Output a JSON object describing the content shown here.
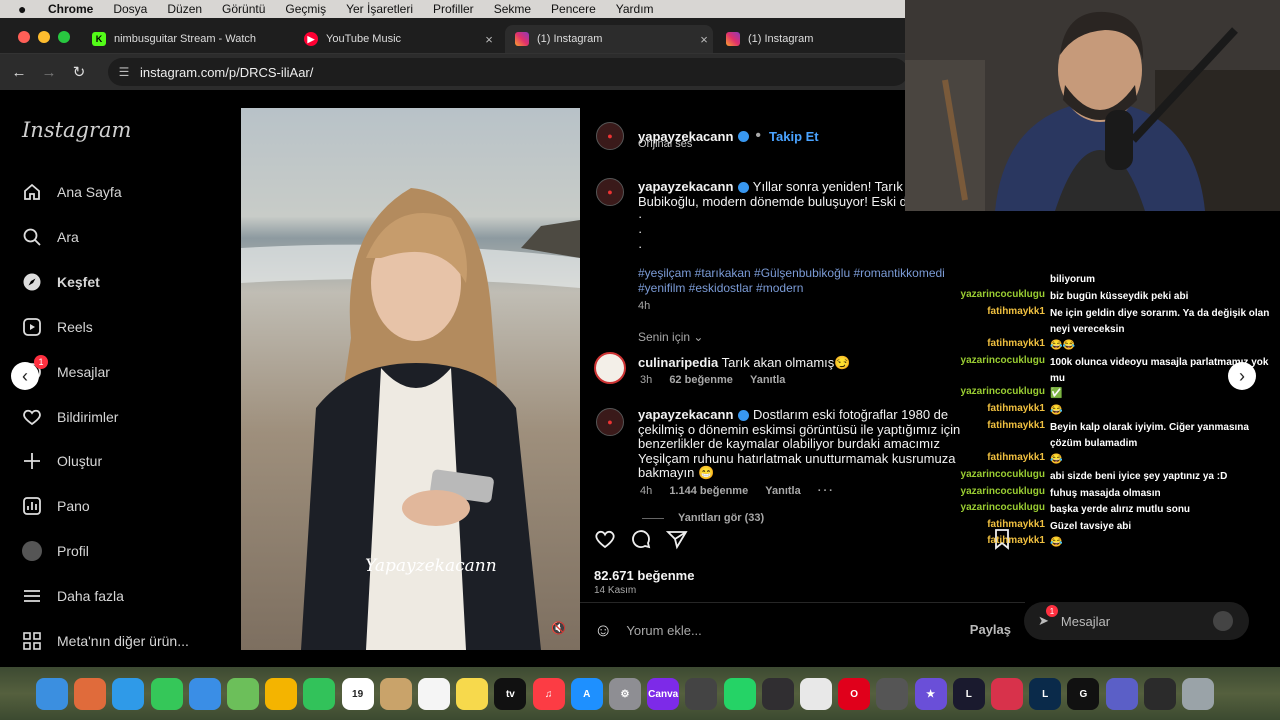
{
  "menubar": {
    "app": "Chrome",
    "items": [
      "Dosya",
      "Düzen",
      "Görüntü",
      "Geçmiş",
      "Yer İşaretleri",
      "Profiller",
      "Sekme",
      "Pencere",
      "Yardım"
    ]
  },
  "tabs": [
    {
      "title": "nimbusguitar Stream - Watch",
      "icon": "kick-icon",
      "color": "#53fc18"
    },
    {
      "title": "YouTube Music",
      "icon": "youtube-music-icon",
      "color": "#ff0033"
    },
    {
      "title": "(1) Instagram",
      "icon": "instagram-icon",
      "color": "#e1306c"
    },
    {
      "title": "(1) Instagram",
      "icon": "instagram-icon",
      "color": "#e1306c"
    }
  ],
  "address": {
    "url": "instagram.com/p/DRCS-iliAar/"
  },
  "sidebar": {
    "logo": "Instagram",
    "items": [
      {
        "label": "Ana Sayfa",
        "icon": "home-icon"
      },
      {
        "label": "Ara",
        "icon": "search-icon"
      },
      {
        "label": "Keşfet",
        "icon": "compass-icon"
      },
      {
        "label": "Reels",
        "icon": "reels-icon"
      },
      {
        "label": "Mesajlar",
        "icon": "messenger-icon",
        "badge": "1"
      },
      {
        "label": "Bildirimler",
        "icon": "heart-icon"
      },
      {
        "label": "Oluştur",
        "icon": "plus-icon"
      },
      {
        "label": "Pano",
        "icon": "dashboard-icon"
      },
      {
        "label": "Profil",
        "icon": "avatar"
      },
      {
        "label": "Daha fazla",
        "icon": "menu-icon"
      },
      {
        "label": "Meta'nın diğer ürün...",
        "icon": "apps-icon"
      }
    ]
  },
  "post": {
    "watermark": "Yapayzekacann",
    "author": "yapayzekacann",
    "follow": "Takip Et",
    "audio": "Orijinal ses",
    "caption_user": "yapayzekacann",
    "caption_line1": "Yıllar sonra yeniden! Tarık A",
    "caption_line2": "Bubikoğlu, modern dönemde buluşuyor! Eski d",
    "dots": [
      "·",
      "·",
      "·"
    ],
    "hashtags_line1": "#yeşilçam #tarıkakan #Gülşenbubikoğlu #romantikkomedi",
    "hashtags_line2": "#yenifilm #eskidostlar #modern",
    "caption_time": "4h",
    "for_you": "Senin için",
    "comments": [
      {
        "user": "culinaripedia",
        "text": "Tarık akan olmamış😏",
        "time": "3h",
        "likes": "62 beğenme",
        "reply": "Yanıtla"
      },
      {
        "user": "yapayzekacann",
        "text": "Dostlarım eski fotoğraflar 1980 de çekilmiş o dönemin eskimsi görüntüsü ile yaptığımız için benzerlikler de kaymalar olabiliyor burdaki amacımız Yeşilçam ruhunu hatırlatmak unutturmamak kusrumuza bakmayın 😁",
        "time": "4h",
        "likes": "1.144 beğenme",
        "reply": "Yanıtla"
      }
    ],
    "view_replies": "Yanıtları gör (33)",
    "likes_total": "82.671 beğenme",
    "date": "14 Kasım",
    "comment_placeholder": "Yorum ekle...",
    "share": "Paylaş"
  },
  "chat": [
    {
      "user": "",
      "msg": "biliyorum",
      "color": "#f0e68c"
    },
    {
      "user": "yazarincocuklugu",
      "msg": "biz bugün küsseydik peki abi",
      "color": "#9acd32"
    },
    {
      "user": "fatihmaykk1",
      "msg": "Ne için geldin diye sorarım. Ya da değişik olan neyi vereceksin",
      "color": "#f0c040"
    },
    {
      "user": "fatihmaykk1",
      "msg": "😂😂",
      "color": "#f0c040"
    },
    {
      "user": "yazarincocuklugu",
      "msg": "100k olunca videoyu masajla parlatmamız yok mu",
      "color": "#9acd32"
    },
    {
      "user": "yazarincocuklugu",
      "msg": "✅",
      "color": "#9acd32"
    },
    {
      "user": "fatihmaykk1",
      "msg": "😂",
      "color": "#f0c040"
    },
    {
      "user": "fatihmaykk1",
      "msg": "Beyin kalp olarak iyiyim. Ciğer yanmasına çözüm bulamadim",
      "color": "#f0c040"
    },
    {
      "user": "fatihmaykk1",
      "msg": "😂",
      "color": "#f0c040"
    },
    {
      "user": "yazarincocuklugu",
      "msg": "abi sizde beni iyice şey yaptınız ya :D",
      "color": "#9acd32"
    },
    {
      "user": "yazarincocuklugu",
      "msg": "fuhuş masajda olmasın",
      "color": "#9acd32"
    },
    {
      "user": "yazarincocuklugu",
      "msg": "başka yerde alırız mutlu sonu",
      "color": "#9acd32"
    },
    {
      "user": "fatihmaykk1",
      "msg": "Güzel tavsiye abi",
      "color": "#f0c040"
    },
    {
      "user": "fatihmaykk1",
      "msg": "😂",
      "color": "#f0c040"
    }
  ],
  "messages_bar": {
    "label": "Mesajlar",
    "badge": "1"
  },
  "dock": [
    {
      "name": "finder-icon",
      "color": "#3b8fe0",
      "label": ""
    },
    {
      "name": "launchpad-icon",
      "color": "#e06b3b",
      "label": ""
    },
    {
      "name": "safari-icon",
      "color": "#2f9ae8",
      "label": ""
    },
    {
      "name": "messages-icon",
      "color": "#35c759",
      "label": ""
    },
    {
      "name": "mail-icon",
      "color": "#3a8ee6",
      "label": ""
    },
    {
      "name": "maps-icon",
      "color": "#6cbf5a",
      "label": ""
    },
    {
      "name": "photos-icon",
      "color": "#f4b400",
      "label": ""
    },
    {
      "name": "facetime-icon",
      "color": "#32c25a",
      "label": ""
    },
    {
      "name": "calendar-icon",
      "color": "#ffffff",
      "label": "19"
    },
    {
      "name": "contacts-icon",
      "color": "#c9a36a",
      "label": ""
    },
    {
      "name": "reminders-icon",
      "color": "#f5f5f5",
      "label": ""
    },
    {
      "name": "notes-icon",
      "color": "#f7d94c",
      "label": ""
    },
    {
      "name": "appletv-icon",
      "color": "#111111",
      "label": "tv"
    },
    {
      "name": "music-icon",
      "color": "#fc3c44",
      "label": "♫"
    },
    {
      "name": "appstore-icon",
      "color": "#1e90ff",
      "label": "A"
    },
    {
      "name": "settings-icon",
      "color": "#8e8e93",
      "label": "⚙"
    },
    {
      "name": "canva-icon",
      "color": "#7d2ae8",
      "label": "Canva"
    },
    {
      "name": "screenshot-icon",
      "color": "#444444",
      "label": ""
    },
    {
      "name": "whatsapp-icon",
      "color": "#25d366",
      "label": ""
    },
    {
      "name": "obs-icon",
      "color": "#302e31",
      "label": ""
    },
    {
      "name": "chrome-icon",
      "color": "#e8e8e8",
      "label": ""
    },
    {
      "name": "opera-icon",
      "color": "#e0001b",
      "label": "O"
    },
    {
      "name": "calculator-icon",
      "color": "#555555",
      "label": ""
    },
    {
      "name": "imovie-icon",
      "color": "#6a4fd8",
      "label": "★"
    },
    {
      "name": "league-icon",
      "color": "#1a1a2e",
      "label": "L"
    },
    {
      "name": "streamlabs-icon",
      "color": "#d8324b",
      "label": ""
    },
    {
      "name": "league-client-icon",
      "color": "#0a2a4a",
      "label": "L"
    },
    {
      "name": "capcut-icon",
      "color": "#111111",
      "label": "G"
    },
    {
      "name": "teams-icon",
      "color": "#5b5fc7",
      "label": ""
    },
    {
      "name": "folder-icon",
      "color": "#2b2b2b",
      "label": ""
    },
    {
      "name": "trash-icon",
      "color": "#9aa3a8",
      "label": ""
    }
  ]
}
